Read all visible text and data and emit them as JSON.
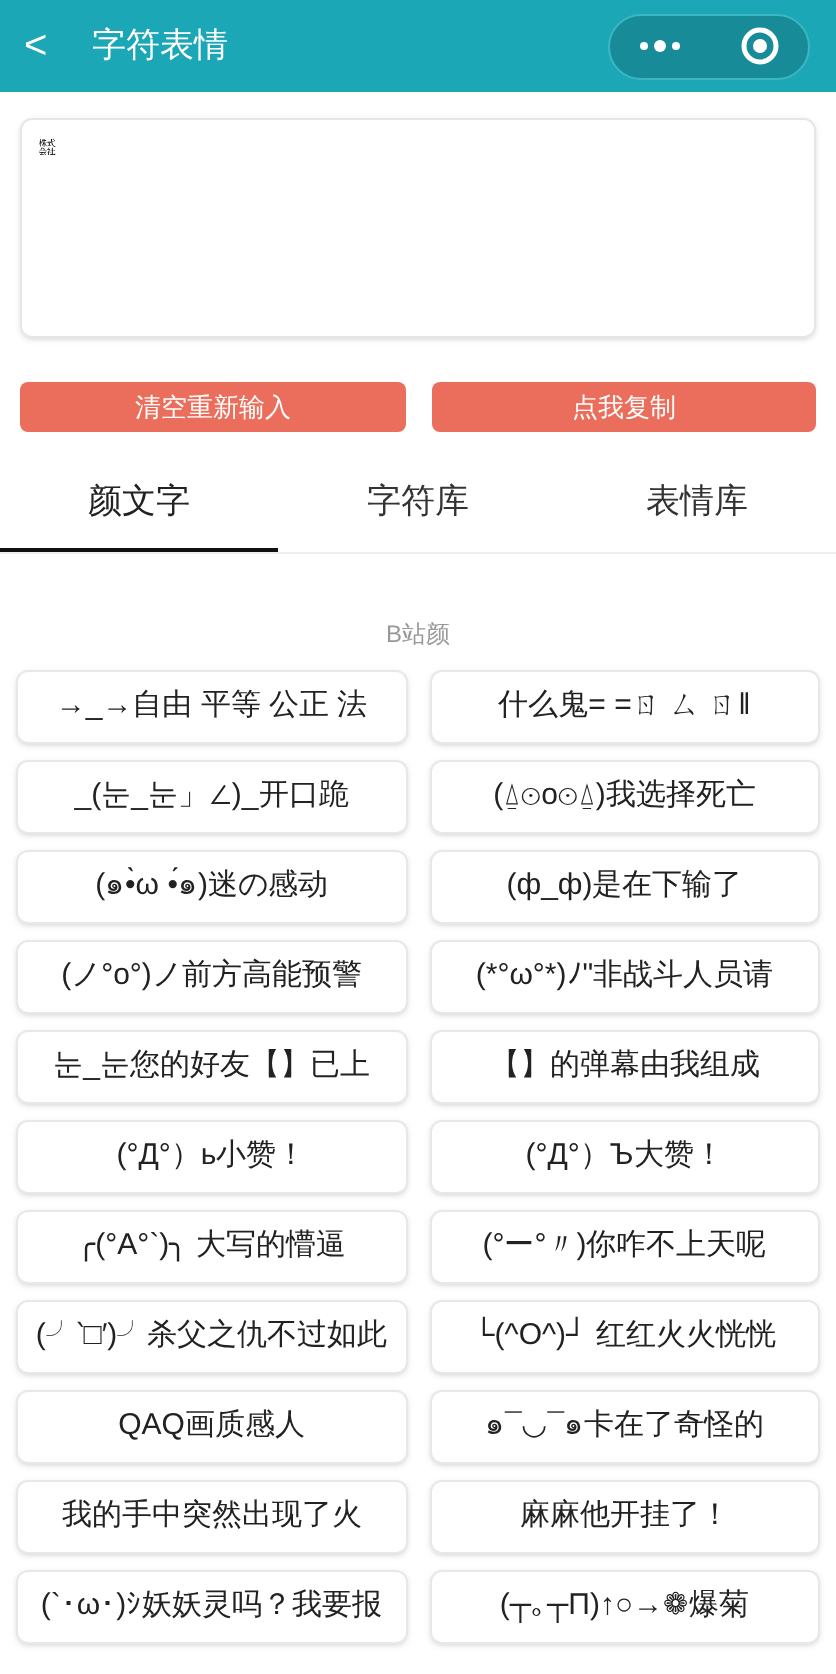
{
  "header": {
    "back": "<",
    "title": "字符表情"
  },
  "input": {
    "value": "㍿"
  },
  "buttons": [
    "清空重新输入",
    "点我复制"
  ],
  "tabs": [
    {
      "label": "颜文字",
      "selected": true
    },
    {
      "label": "字符库",
      "selected": false
    },
    {
      "label": "表情库",
      "selected": false
    }
  ],
  "section": {
    "title": "B站颜",
    "items": [
      "→_→自由 平等 公正 法",
      "什么鬼= =ㄖ ㄙ ㄖ‖",
      "_(눈_눈」∠)_开口跪",
      "(⍙⊙o⊙⍙)我选择死亡",
      "(๑•̀ω •́๑)迷の感动",
      "(ф_ф)是在下输了",
      "(ノ°o°)ノ前方高能预警",
      "(*°ω°*)ﾉ\"非战斗人员请",
      "눈_눈您的好友【】已上",
      "【】的弹幕由我组成",
      "(°Д°）ь小赞！",
      "(°Д°）Ъ大赞！",
      "╭(°A°`)╮ 大写的懵逼",
      "(°ー°〃)你咋不上天呢",
      "(╯‵□′)╯杀父之仇不过如此",
      "└(^O^)┘ 红红火火恍恍",
      "QAQ画质感人",
      "๑¯◡¯๑卡在了奇怪的",
      "我的手中突然出现了火",
      "麻麻他开挂了！",
      "(`･ω･)ｼ妖妖灵吗？我要报",
      "(┬｡┬Π)↑○→❁爆菊"
    ]
  }
}
